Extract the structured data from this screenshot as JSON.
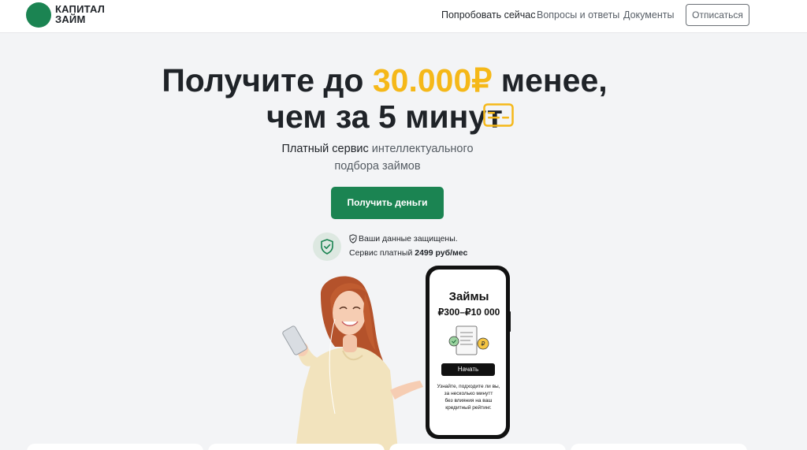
{
  "header": {
    "logo_line1": "КАПИТАЛ",
    "logo_line2": "ЗАЙМ",
    "nav": {
      "try_now": "Попробовать сейчас",
      "faq": "Вопросы и ответы",
      "documents": "Документы"
    },
    "unsubscribe_label": "Отписаться"
  },
  "hero": {
    "line1_prefix": "Получите до ",
    "line1_amount": "30.000₽",
    "line1_suffix": " менее,",
    "line2": "чем за 5 минут",
    "subtitle_strong": "Платный сервис",
    "subtitle_rest": " интеллектуального",
    "subtitle_line2": "подбора займов",
    "cta_label": "Получить деньги"
  },
  "security": {
    "line1": "Ваши данные защищены.",
    "line2_prefix": "Сервис платный ",
    "line2_price": "2499 руб/мес"
  },
  "phone": {
    "title": "Займы",
    "range": "₽300–₽10 000",
    "start_label": "Начать",
    "note_line1": "Узнайте, подходите ли вы,",
    "note_line2": "за несколько минутт",
    "note_line3": "без влияния на ваш",
    "note_line4": "кредитный рейтинг."
  },
  "colors": {
    "brand_green": "#1b8452",
    "accent_yellow": "#f5b819",
    "background": "#f3f4f6"
  }
}
